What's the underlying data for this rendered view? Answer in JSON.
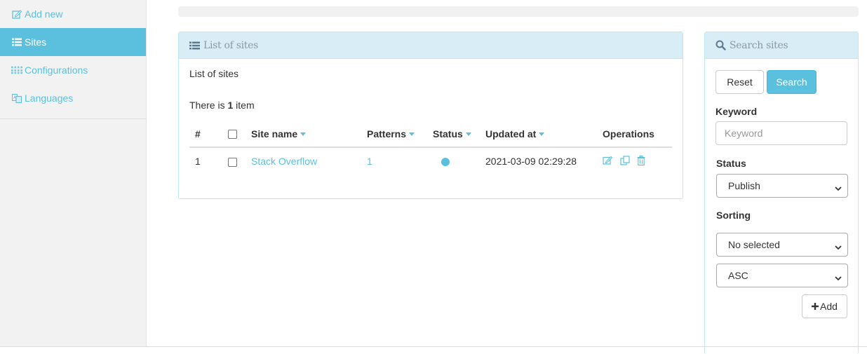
{
  "sidebar": {
    "items": [
      {
        "label": "Add new",
        "icon": "edit-icon",
        "active": false
      },
      {
        "label": "Sites",
        "icon": "list-icon",
        "active": true
      },
      {
        "label": "Configurations",
        "icon": "grid-icon",
        "active": false
      },
      {
        "label": "Languages",
        "icon": "language-icon",
        "active": false
      }
    ]
  },
  "list_panel": {
    "heading": "List of sites",
    "title": "List of sites",
    "count_prefix": "There is ",
    "count": "1",
    "count_suffix": " item",
    "columns": [
      "#",
      "",
      "Site name",
      "Patterns",
      "Status",
      "Updated at",
      "Operations"
    ],
    "rows": [
      {
        "num": "1",
        "site_name": "Stack Overflow",
        "patterns": "1",
        "status": "published",
        "updated_at": "2021-03-09 02:29:28"
      }
    ]
  },
  "search_panel": {
    "heading": "Search sites",
    "reset_label": "Reset",
    "search_label": "Search",
    "keyword_label": "Keyword",
    "keyword_placeholder": "Keyword",
    "keyword_value": "",
    "status_label": "Status",
    "status_value": "Publish",
    "sorting_label": "Sorting",
    "sorting_field_value": "No selected",
    "sorting_order_value": "ASC",
    "add_label": "Add"
  },
  "colors": {
    "accent": "#5bc0de",
    "panel_heading_bg": "#d9edf7",
    "panel_border": "#bce8f1",
    "sidebar_bg": "#f2f2f2"
  }
}
